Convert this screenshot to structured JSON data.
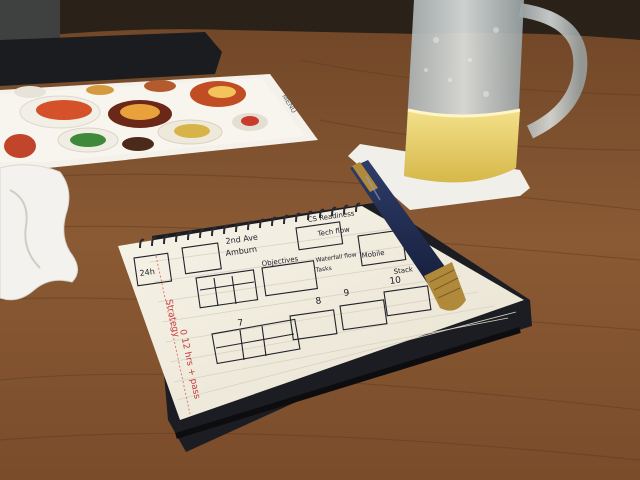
{
  "scene": {
    "objects": [
      "wooden-table",
      "restaurant-menu",
      "paper-napkin",
      "beer-mug",
      "coaster",
      "spiral-notebook",
      "navy-gold-pen"
    ]
  },
  "menu": {
    "spine_text": "MENU"
  },
  "notebook": {
    "sketch_notes": [
      {
        "text": "2nd Ave"
      },
      {
        "text": "Amburn"
      },
      {
        "text": "Objectives"
      },
      {
        "text": "CS Readiness"
      },
      {
        "text": "Tech flow"
      },
      {
        "text": "Waterfall flow"
      },
      {
        "text": "Tasks"
      },
      {
        "text": "Mobile"
      },
      {
        "text": "Stack"
      },
      {
        "text": "24h"
      },
      {
        "text": "8"
      },
      {
        "text": "9"
      },
      {
        "text": "10"
      },
      {
        "text": "7"
      }
    ],
    "margin_notes": [
      "Strategy",
      "0 12 hrs + pass"
    ]
  },
  "colors": {
    "table": "#8a5a34",
    "paper": "#f3efe2",
    "pen_body": "#1e2a4e",
    "pen_cap": "#b08a3a",
    "beer": "#e6cf6a"
  }
}
